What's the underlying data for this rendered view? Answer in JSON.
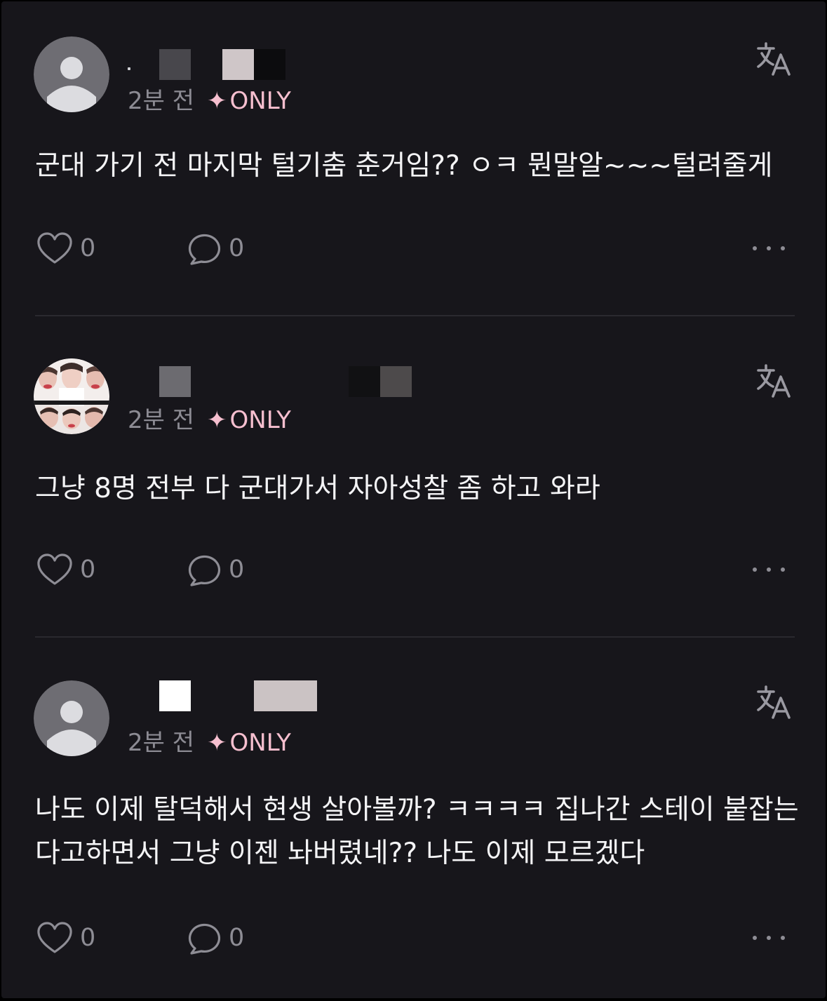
{
  "colors": {
    "background": "#17161b",
    "text": "#f4f4f6",
    "muted": "#8c8b93",
    "accent_pink": "#f6bfcf",
    "divider": "#2a292f"
  },
  "comments": [
    {
      "avatar": "default-avatar",
      "time": "2분 전",
      "badge_icon": "✦",
      "badge_text": "ONLY",
      "text": "군대 가기 전 마지막 털기춤 춘거임?? ㅇㅋ 뭔말알~~~털려줄게",
      "likes": "0",
      "replies": "0"
    },
    {
      "avatar": "photo-avatar",
      "time": "2분 전",
      "badge_icon": "✦",
      "badge_text": "ONLY",
      "text": "그냥 8명 전부 다 군대가서 자아성찰 좀 하고 와라",
      "likes": "0",
      "replies": "0"
    },
    {
      "avatar": "default-avatar",
      "time": "2분 전",
      "badge_icon": "✦",
      "badge_text": "ONLY",
      "text": "나도 이제 탈덕해서 현생 살아볼까? ㅋㅋㅋㅋ 집나간 스테이 붙잡는다고하면서 그냥 이젠 놔버렸네?? 나도 이제 모르겠다",
      "likes": "0",
      "replies": "0"
    }
  ]
}
